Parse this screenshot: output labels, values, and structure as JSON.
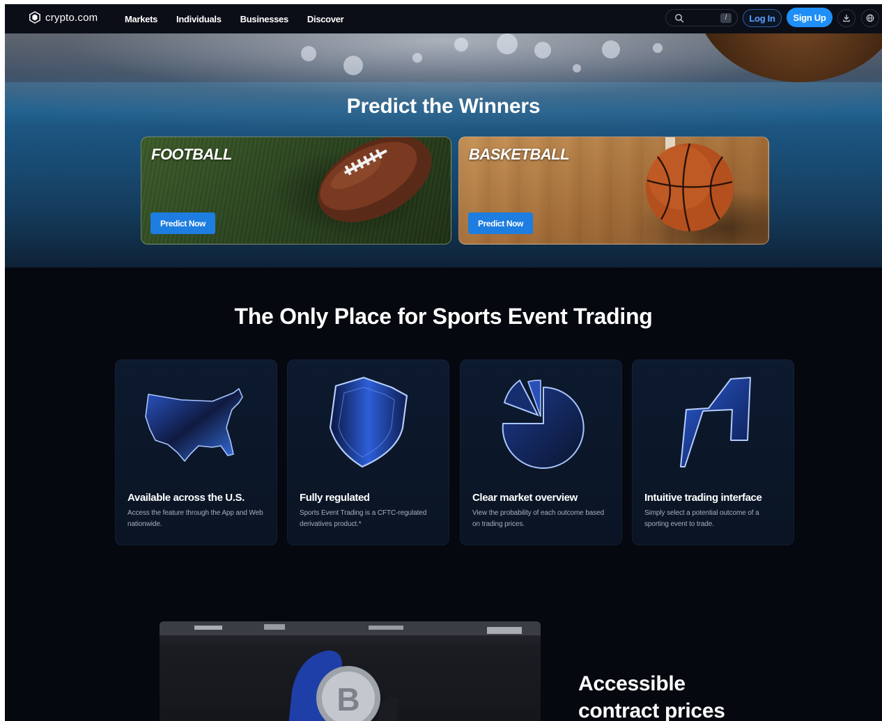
{
  "nav": {
    "logo_text": "crypto.com",
    "links": [
      "Markets",
      "Individuals",
      "Businesses",
      "Discover"
    ],
    "search_placeholder": "",
    "search_shortcut": "/",
    "login_label": "Log In",
    "signup_label": "Sign Up",
    "icons": [
      "download-icon",
      "globe-icon"
    ]
  },
  "hero": {
    "title": "Predict the Winners",
    "cards": [
      {
        "label": "FOOTBALL",
        "button": "Predict Now"
      },
      {
        "label": "BASKETBALL",
        "button": "Predict Now"
      }
    ]
  },
  "features": {
    "title": "The Only Place for Sports Event Trading",
    "items": [
      {
        "icon": "usa-map-icon",
        "title": "Available across the U.S.",
        "desc": "Access the feature through the App and Web nationwide."
      },
      {
        "icon": "shield-icon",
        "title": "Fully regulated",
        "desc": "Sports Event Trading is a CFTC-regulated derivatives product.*"
      },
      {
        "icon": "pie-chart-icon",
        "title": "Clear market overview",
        "desc": "View the probability of each outcome based on trading prices."
      },
      {
        "icon": "lightning-icon",
        "title": "Intuitive trading interface",
        "desc": "Simply select a potential outcome of a sporting event to trade."
      }
    ]
  },
  "bottom": {
    "title_line1": "Accessible",
    "title_line2": "contract prices"
  },
  "colors": {
    "accent": "#1f8ff7",
    "button_blue": "#1d7de0",
    "page_bg": "#06080f",
    "card_bg": "#0d1a2e"
  }
}
